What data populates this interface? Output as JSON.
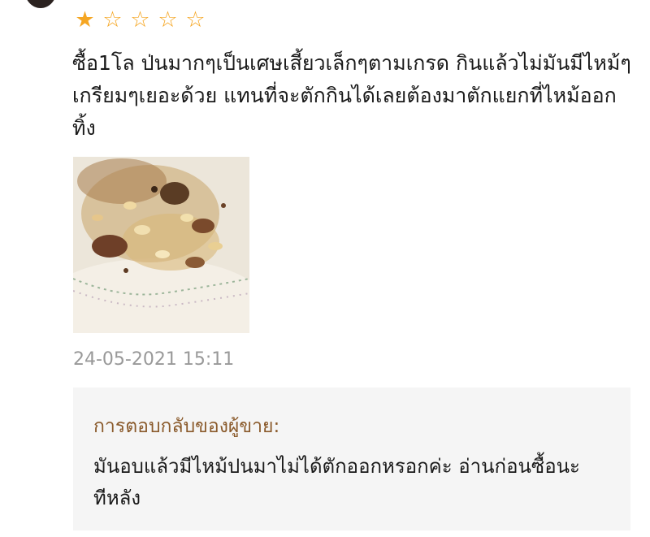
{
  "review": {
    "rating": 1,
    "max_rating": 5,
    "star_color": "#f5a623",
    "text": "ซื้อ1โล ป่นมากๆเป็นเศษเสี้ยวเล็กๆตามเกรด กินแล้วไม่มันมีไหม้ๆเกรียมๆเยอะด้วย แทนที่จะตักกินได้เลยต้องมาตักแยกที่ไหม้ออกทิ้ง",
    "date": "24-05-2021 15:11"
  },
  "seller_reply": {
    "title": "การตอบกลับของผู้ขาย:",
    "text": "มันอบแล้วมีไหม้ปนมาไม่ได้ตักออกหรอกค่ะ อ่านก่อนซื้อนะทีหลัง",
    "title_color": "#8a5a2b"
  }
}
